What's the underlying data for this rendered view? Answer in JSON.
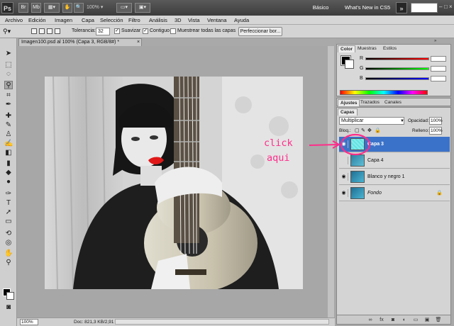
{
  "app": {
    "logo": "Ps",
    "icons": [
      "Br",
      "Mb"
    ],
    "zoom_level": "100%",
    "workspaces": {
      "basic": "Básico",
      "whats_new": "What's New in CS5",
      "more": "»"
    }
  },
  "menu": [
    "Archivo",
    "Edición",
    "Imagen",
    "Capa",
    "Selección",
    "Filtro",
    "Análisis",
    "3D",
    "Vista",
    "Ventana",
    "Ayuda"
  ],
  "options": {
    "tolerance_label": "Tolerancia:",
    "tolerance_value": "32",
    "antialias_label": "Suavizar",
    "contiguous_label": "Contiguo",
    "sample_all_label": "Muestrear todas las capas",
    "refine_edge_label": "Perfeccionar bor...",
    "check_mark": "✓"
  },
  "document": {
    "tab_title": "Imagen100.psd al 100% (Capa 3, RGB/8#) *",
    "close": "×",
    "zoom": "100%",
    "doc_size": "Doc: 821,3 KB/2,91 MB"
  },
  "color_panel": {
    "tabs": [
      "Color",
      "Muestras",
      "Estilos"
    ],
    "sliders": [
      {
        "letter": "R",
        "color": "#ff0000"
      },
      {
        "letter": "G",
        "color": "#00ff00"
      },
      {
        "letter": "B",
        "color": "#0000ff"
      }
    ]
  },
  "adjust_tabs": [
    "Ajustes",
    "Trazados",
    "Canales"
  ],
  "layers_panel": {
    "title": "Capas",
    "blend_mode": "Multiplicar",
    "opacity_label": "Opacidad:",
    "opacity_value": "100%",
    "lock_label": "Bloq.:",
    "fill_label": "Relleno:",
    "fill_value": "100%",
    "layers": [
      {
        "name": "Capa 3",
        "selected": true,
        "visible": true,
        "thumb_color": "#5fe3e3"
      },
      {
        "name": "Capa 4",
        "selected": false,
        "visible": false,
        "thumb_color": "#4aa8c8"
      },
      {
        "name": "Blanco y negro 1",
        "selected": false,
        "visible": true,
        "thumb_color": "#3a9fc2"
      },
      {
        "name": "Fondo",
        "selected": false,
        "visible": true,
        "thumb_color": "#3a9fc2",
        "italic": true,
        "locked": true
      }
    ]
  },
  "annotation": {
    "line1": "click",
    "line2": "aqui",
    "color": "#ff2d8a"
  }
}
